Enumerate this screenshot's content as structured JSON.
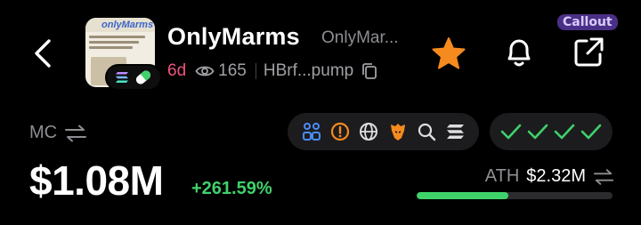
{
  "callout": {
    "label": "Callout"
  },
  "token": {
    "name": "OnlyMarms",
    "sub_name": "OnlyMar...",
    "age": "6d",
    "views": "165",
    "address": "HBrf...pump",
    "thumb_brand": "onlyMarms"
  },
  "market": {
    "mc_label": "MC",
    "price": "$1.08M",
    "change": "+261.59%",
    "ath_label": "ATH",
    "ath_value": "$2.32M",
    "ath_progress": 0.466
  },
  "links": [
    "community-icon",
    "alert-icon",
    "globe-icon",
    "lion-icon",
    "search-icon",
    "solana-icon"
  ],
  "audit_checks": 4,
  "colors": {
    "background": "#000000",
    "age": "#f0567d",
    "positive": "#3fd26b",
    "star": "#f58a1e",
    "callout_bg": "#4a2f86"
  }
}
